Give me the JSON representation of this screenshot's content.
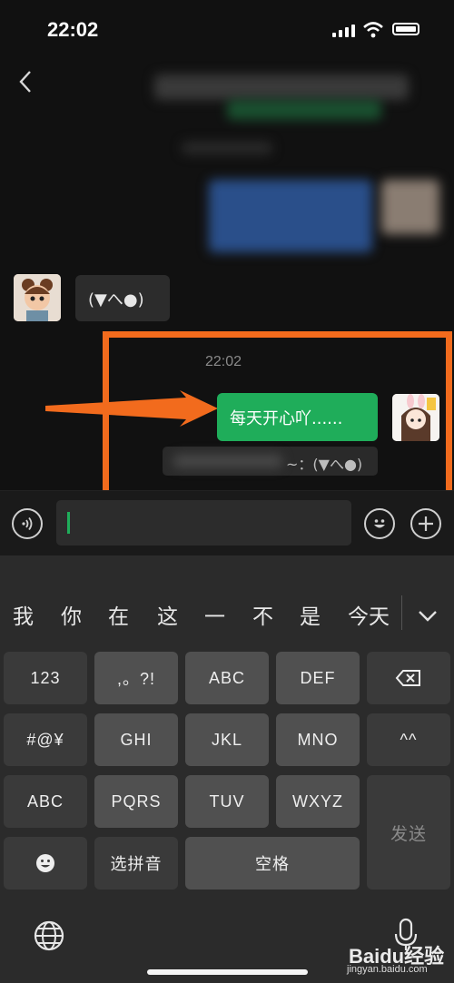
{
  "status_bar": {
    "time": "22:02"
  },
  "chat": {
    "received": {
      "text": "(▼へ●)"
    },
    "timestamp": "22:02",
    "sent": {
      "text": "每天开心吖......"
    },
    "quote": {
      "text": "~：(▼へ●)"
    }
  },
  "keyboard": {
    "candidates": [
      "我",
      "你",
      "在",
      "这",
      "一",
      "不",
      "是",
      "今天"
    ],
    "keys": {
      "num": "123",
      "punct": ",。?!",
      "abc": "ABC",
      "def": "DEF",
      "symbols": "#@¥",
      "ghi": "GHI",
      "jkl": "JKL",
      "mno": "MNO",
      "emoticon": "^^",
      "abc2": "ABC",
      "pqrs": "PQRS",
      "tuv": "TUV",
      "wxyz": "WXYZ",
      "send": "发送",
      "pinyin": "选拼音",
      "space": "空格"
    }
  },
  "watermark": {
    "logo": "Baidu经验",
    "url": "jingyan.baidu.com"
  },
  "colors": {
    "annotation": "#f26b1d",
    "bubble_green": "#1fad5a"
  }
}
